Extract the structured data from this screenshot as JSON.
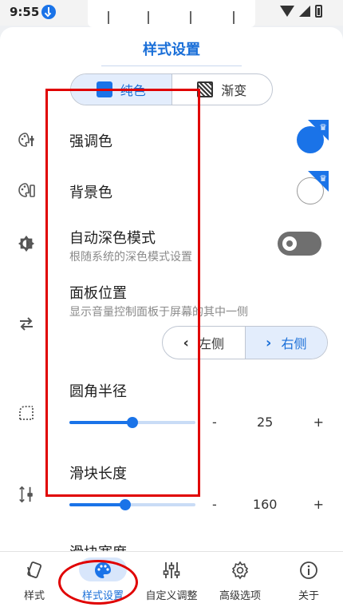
{
  "status_bar": {
    "time": "9:55"
  },
  "sheet": {
    "title": "样式设置"
  },
  "fill_mode": {
    "options": [
      "纯色",
      "渐变"
    ],
    "selected": "纯色"
  },
  "rows": {
    "accent_color": {
      "label": "强调色"
    },
    "background_color": {
      "label": "背景色"
    },
    "auto_dark": {
      "label": "自动深色模式",
      "sublabel": "根随系统的深色模式设置"
    },
    "panel_position": {
      "label": "面板位置",
      "sublabel": "显示音量控制面板于屏幕的其中一侧",
      "options": [
        "左侧",
        "右侧"
      ],
      "selected": "右侧"
    },
    "corner_radius": {
      "label": "圆角半径",
      "value": "25",
      "minus": "-",
      "plus": "+",
      "fraction": 0.5
    },
    "slider_length": {
      "label": "滑块长度",
      "value": "160",
      "minus": "-",
      "plus": "+",
      "fraction": 0.44
    },
    "slider_width": {
      "label": "滑块宽度"
    }
  },
  "bottom_nav": {
    "items": [
      {
        "label": "样式",
        "icon": "style-icon"
      },
      {
        "label": "样式设置",
        "icon": "palette-icon",
        "active": true
      },
      {
        "label": "自定义调整",
        "icon": "sliders-icon"
      },
      {
        "label": "高级选项",
        "icon": "gear-icon"
      },
      {
        "label": "关于",
        "icon": "info-icon"
      }
    ]
  },
  "colors": {
    "accent": "#1a73e8",
    "highlight_annotation": "#e00000"
  }
}
